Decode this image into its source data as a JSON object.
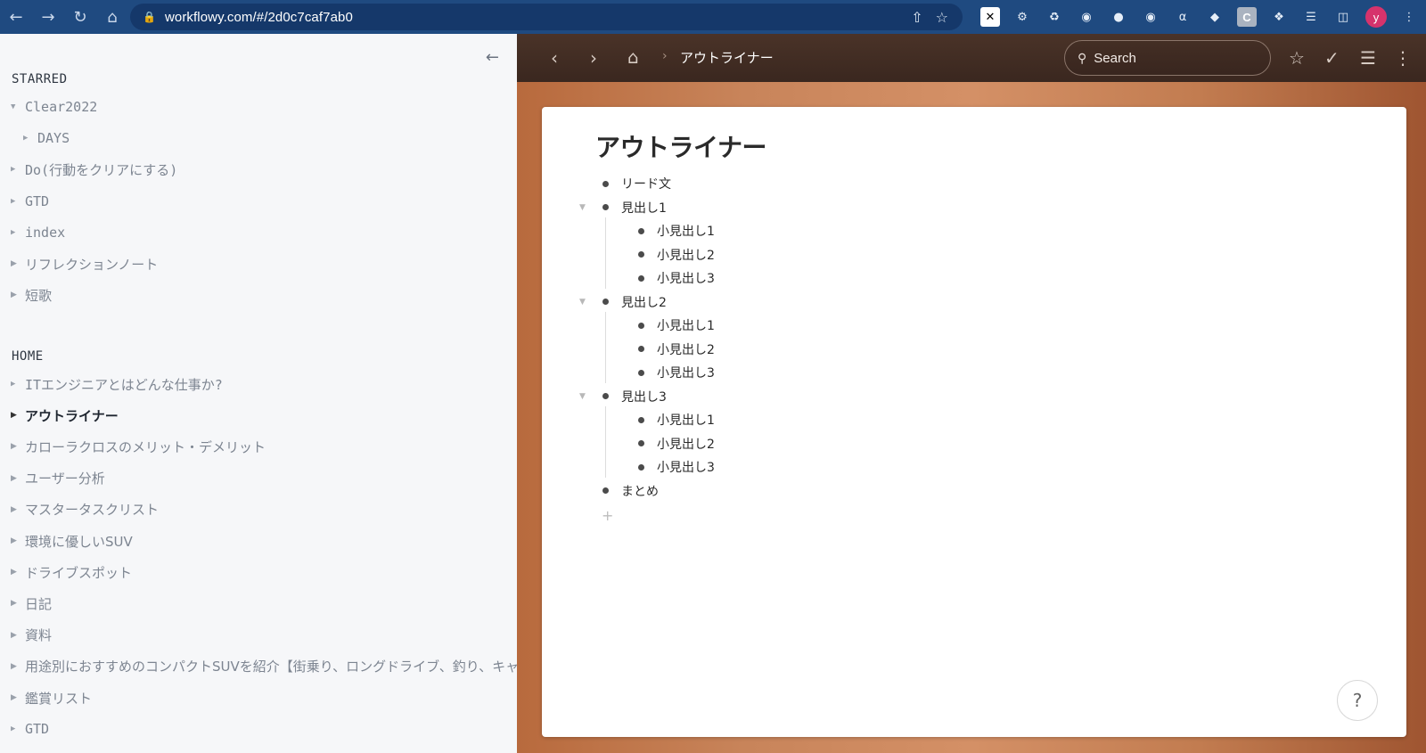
{
  "browser": {
    "url": "workflowy.com/#/2d0c7caf7ab0",
    "ext_c_label": "C",
    "avatar_letter": "y"
  },
  "sidebar": {
    "starred_title": "STARRED",
    "starred": [
      {
        "label": "Clear2022",
        "expanded": true
      },
      {
        "label": "DAYS",
        "child": true
      },
      {
        "label": "Do(行動をクリアにする)"
      },
      {
        "label": "GTD"
      },
      {
        "label": "index"
      },
      {
        "label": "リフレクションノート"
      },
      {
        "label": "短歌"
      }
    ],
    "home_title": "HOME",
    "home": [
      {
        "label": "ITエンジニアとはどんな仕事か?"
      },
      {
        "label": "アウトライナー",
        "active": true
      },
      {
        "label": "カローラクロスのメリット・デメリット"
      },
      {
        "label": "ユーザー分析"
      },
      {
        "label": "マスタータスクリスト"
      },
      {
        "label": "環境に優しいSUV"
      },
      {
        "label": "ドライブスポット"
      },
      {
        "label": "日記"
      },
      {
        "label": "資料"
      },
      {
        "label": "用途別におすすめのコンパクトSUVを紹介【街乗り、ロングドライブ、釣り、キャンプ"
      },
      {
        "label": "鑑賞リスト"
      },
      {
        "label": "GTD"
      }
    ]
  },
  "topbar": {
    "breadcrumb": "アウトライナー",
    "search_placeholder": "Search"
  },
  "document": {
    "title": "アウトライナー",
    "items": [
      {
        "label": "リード文"
      },
      {
        "label": "見出し1",
        "children": [
          "小見出し1",
          "小見出し2",
          "小見出し3"
        ]
      },
      {
        "label": "見出し2",
        "children": [
          "小見出し1",
          "小見出し2",
          "小見出し3"
        ]
      },
      {
        "label": "見出し3",
        "children": [
          "小見出し1",
          "小見出し2",
          "小見出し3"
        ]
      },
      {
        "label": "まとめ"
      }
    ]
  },
  "help_label": "?"
}
